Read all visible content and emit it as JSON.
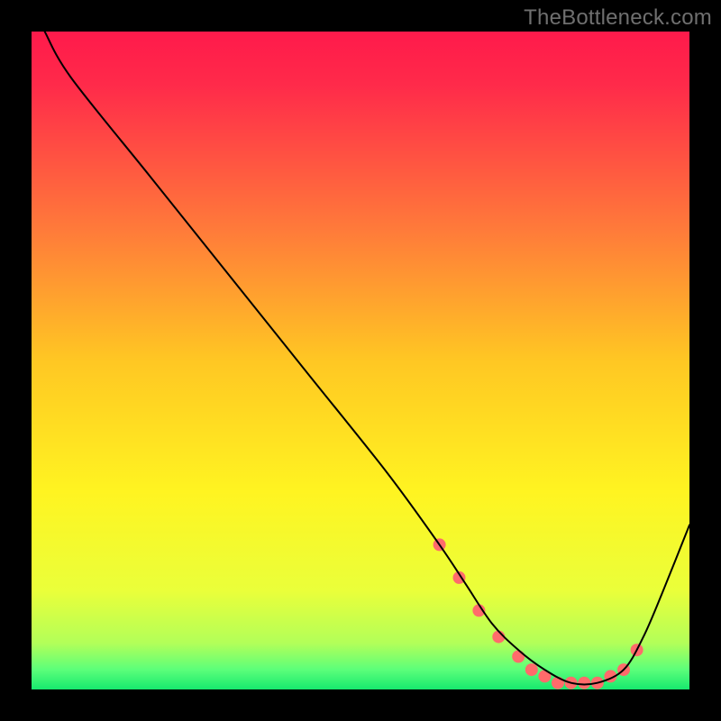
{
  "watermark": "TheBottleneck.com",
  "chart_data": {
    "type": "line",
    "title": "",
    "xlabel": "",
    "ylabel": "",
    "xlim": [
      0,
      100
    ],
    "ylim": [
      0,
      100
    ],
    "grid": false,
    "legend": false,
    "curve": {
      "name": "bottleneck-curve",
      "x": [
        2,
        6,
        18,
        30,
        42,
        54,
        62,
        66,
        70,
        74,
        78,
        82,
        86,
        90,
        93,
        96,
        100
      ],
      "y": [
        100,
        93,
        78,
        63,
        48,
        33,
        22,
        16,
        10,
        6,
        3,
        1,
        1,
        3,
        8,
        15,
        25
      ],
      "stroke": "#000000",
      "stroke_width": 2
    },
    "markers": {
      "name": "highlight-points",
      "x": [
        62,
        65,
        68,
        71,
        74,
        76,
        78,
        80,
        82,
        84,
        86,
        88,
        90,
        92
      ],
      "y": [
        22,
        17,
        12,
        8,
        5,
        3,
        2,
        1,
        1,
        1,
        1,
        2,
        3,
        6
      ],
      "fill": "#ff6b6b",
      "radius": 7
    },
    "background_gradient": {
      "stops": [
        {
          "offset": 0.0,
          "color": "#ff1a4b"
        },
        {
          "offset": 0.08,
          "color": "#ff2a4a"
        },
        {
          "offset": 0.3,
          "color": "#ff7a3a"
        },
        {
          "offset": 0.5,
          "color": "#ffc723"
        },
        {
          "offset": 0.7,
          "color": "#fff421"
        },
        {
          "offset": 0.85,
          "color": "#eaff3a"
        },
        {
          "offset": 0.93,
          "color": "#b2ff59"
        },
        {
          "offset": 0.97,
          "color": "#5bff7a"
        },
        {
          "offset": 1.0,
          "color": "#17e86e"
        }
      ]
    }
  }
}
